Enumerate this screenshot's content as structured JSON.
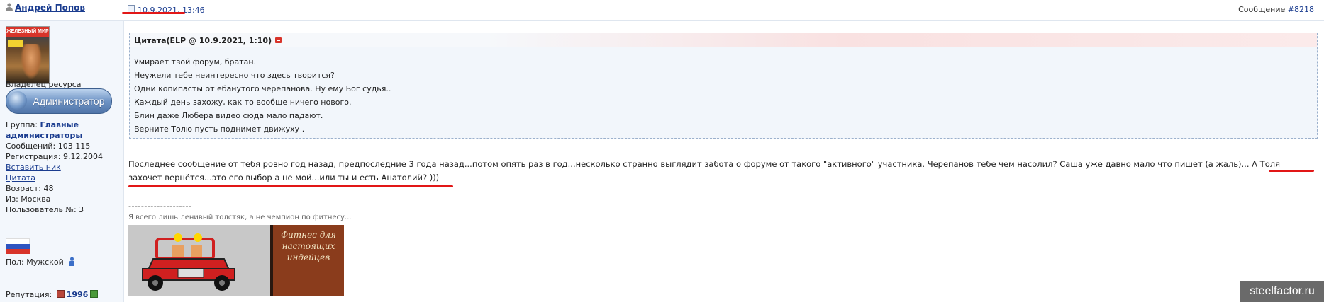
{
  "header": {
    "author": "Андрей Попов",
    "date": "10.9.2021, 13:46",
    "message_label": "Сообщение",
    "message_number": "#8218"
  },
  "sidebar": {
    "owner_label": "Владелец ресурса",
    "admin_badge": "Администратор",
    "group_label": "Группа:",
    "group_value": "Главные администраторы",
    "messages": "Сообщений: 103 115",
    "registration": "Регистрация: 9.12.2004",
    "insert_nick": "Вставить ник",
    "quote_link": "Цитата",
    "age": "Возраст: 48",
    "from": "Из: Москва",
    "user_no": "Пользователь №: 3",
    "gender": "Пол: Мужской",
    "reputation_label": "Репутация:",
    "reputation_value": "1996"
  },
  "quote": {
    "title": "Цитата(ELP @ 10.9.2021, 1:10)",
    "lines": [
      "Умирает твой форум, братан.",
      "Неужели тебе неинтересно что здесь творится?",
      "Одни копипасты от ебанутого черепанова. Ну ему Бог судья..",
      "Каждый день захожу, как то вообще ничего нового.",
      "Блин даже Любера видео сюда мало падают.",
      "Верните Толю пусть поднимет движуху ."
    ]
  },
  "post": {
    "line1": "Последнее сообщение от тебя ровно год назад, предпоследние 3 года назад...потом опять раз в год...несколько странно выглядит забота о форуме от такого \"активного\" участника. Черепанов тебе чем насолил? Саша уже давно мало что пишет (а жаль)... А Толя",
    "line2": "захочет вернётся...это его выбор а не мой...или ты и есть Анатолий? )))"
  },
  "signature": {
    "separator": "--------------------",
    "text": "Я всего лишь ленивый толстяк, а не чемпион по фитнесу...",
    "banner_text": "Фитнес для настоящих индейцев"
  },
  "watermark": "steelfactor.ru",
  "colors": {
    "link": "#1a3c8f",
    "annotation_red": "#e21717",
    "sidebar_bg": "#f3f7fc"
  }
}
